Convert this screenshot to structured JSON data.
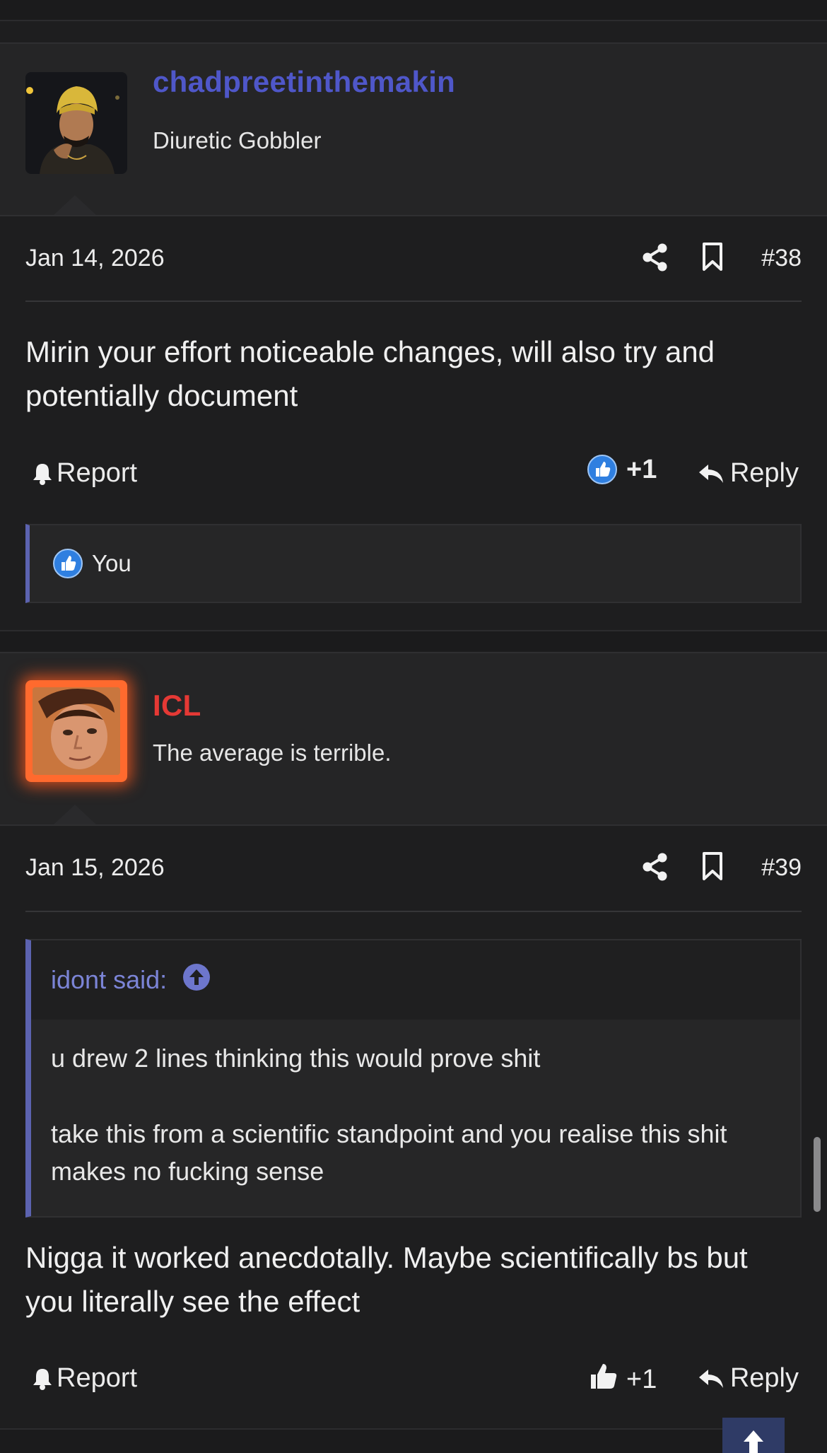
{
  "posts": [
    {
      "username": "chadpreetinthemakin",
      "username_color": "#4f57c9",
      "user_title": "Diuretic Gobbler",
      "date": "Jan 14, 2026",
      "number": "#38",
      "body": "Mirin your effort noticeable changes, will also try and potentially document",
      "report_label": "Report",
      "like_count": "+1",
      "reply_label": "Reply",
      "reactions": {
        "users": "You"
      }
    },
    {
      "username": "ICL",
      "username_color": "#e53935",
      "user_title": "The average is terrible.",
      "date": "Jan 15, 2026",
      "number": "#39",
      "quote": {
        "author_label": "idont said:",
        "lines": [
          "u drew 2 lines thinking this would prove shit",
          "take this from a scientific standpoint and you realise this shit makes no fucking sense"
        ]
      },
      "body": "Nigga it worked anecdotally. Maybe scientifically bs but you literally see the effect",
      "report_label": "Report",
      "like_count": "+1",
      "reply_label": "Reply"
    }
  ],
  "colors": {
    "background": "#1e1e1f",
    "accent": "#5c63b0",
    "like_blue": "#2f7fe0"
  },
  "icons": [
    "share-icon",
    "bookmark-icon",
    "bell-icon",
    "thumbs-up-icon",
    "reply-arrow-icon",
    "arrow-up-circle-icon",
    "arrow-up-icon"
  ]
}
